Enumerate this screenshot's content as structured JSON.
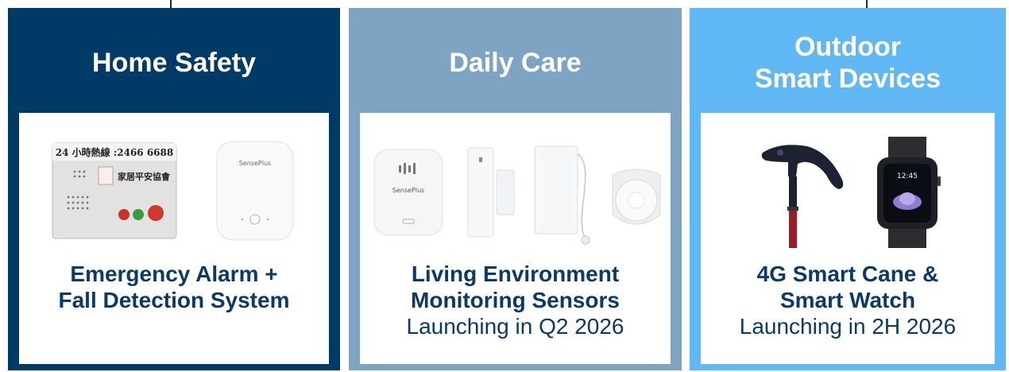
{
  "colors": {
    "card1": "#003a67",
    "card2": "#7da5c3",
    "card3": "#5fb7f3",
    "caption": "#0b3a66"
  },
  "cards": [
    {
      "title": "Home Safety",
      "caption": "Emergency Alarm +\nFall Detection System",
      "subcaption": "",
      "images": {
        "alarm_hotline": "24 小時熱線 :2466 6688",
        "alarm_org": "家居平安協會",
        "sensor_brand": "SensePlus"
      }
    },
    {
      "title": "Daily Care",
      "caption": "Living Environment\nMonitoring Sensors",
      "subcaption": "Launching in Q2 2026",
      "images": {
        "sensor_brand": "SensePlus"
      }
    },
    {
      "title": "Outdoor\nSmart Devices",
      "caption": "4G Smart Cane &\nSmart Watch",
      "subcaption": "Launching in 2H 2026",
      "images": {
        "watch_time": "12:45"
      }
    }
  ]
}
